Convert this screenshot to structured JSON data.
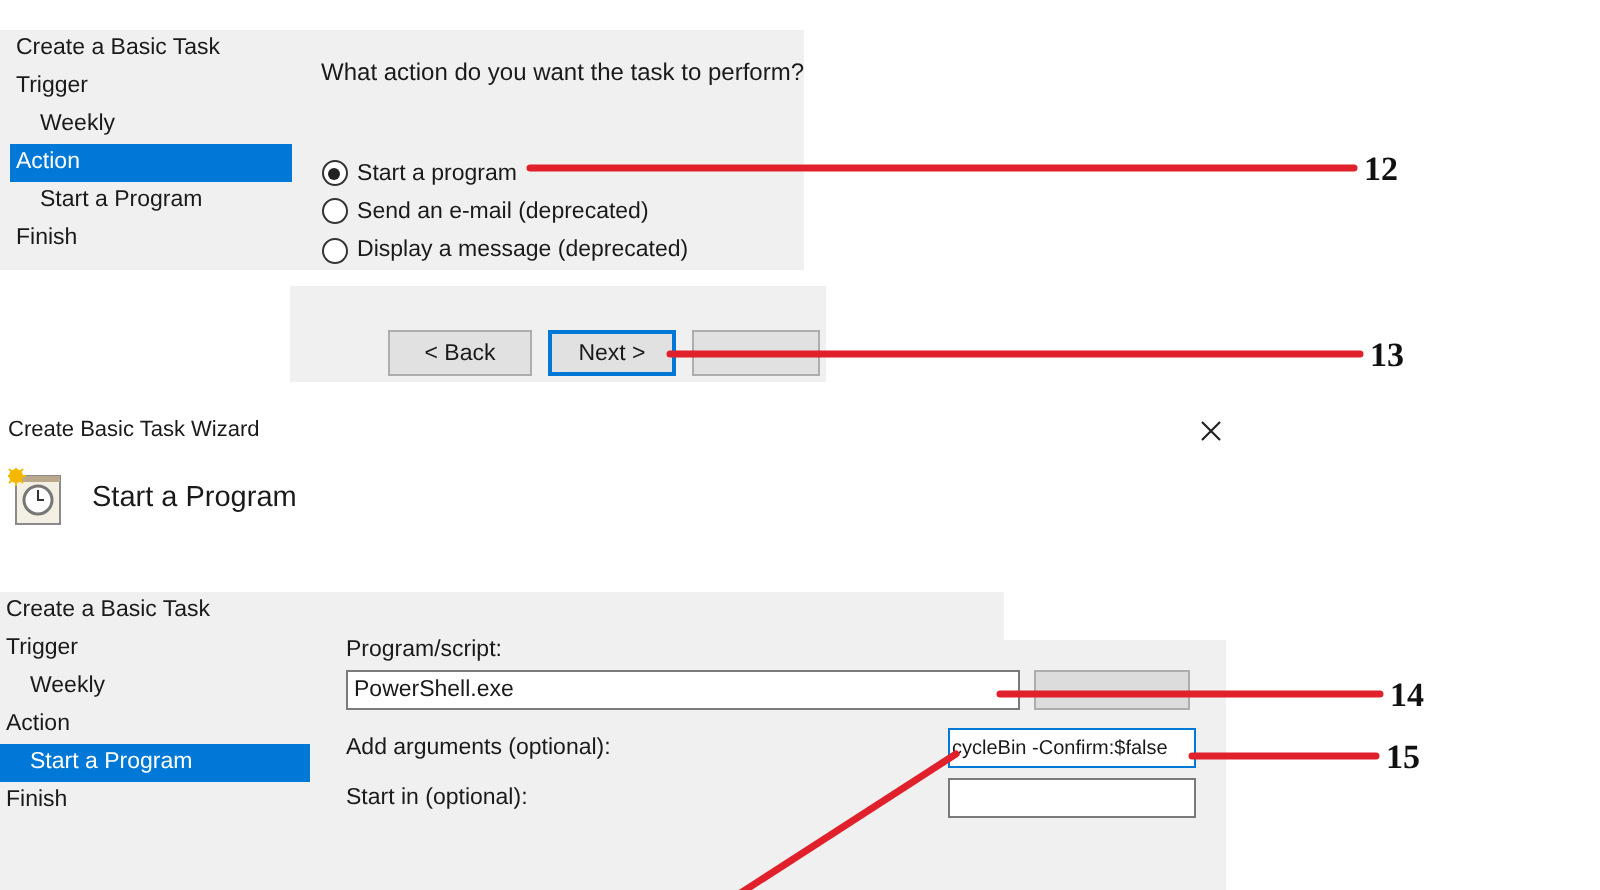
{
  "action_step": {
    "sidebar": [
      {
        "label": "Create a Basic Task",
        "selected": false
      },
      {
        "label": "Trigger",
        "selected": false,
        "children": [
          {
            "label": "Weekly",
            "selected": false
          }
        ]
      },
      {
        "label": "Action",
        "selected": true,
        "children": [
          {
            "label": "Start a Program",
            "selected": false
          }
        ]
      },
      {
        "label": "Finish",
        "selected": false
      }
    ],
    "question": "What action do you want the task to perform?",
    "options": [
      {
        "label": "Start a program",
        "selected": true
      },
      {
        "label": "Send an e-mail (deprecated)",
        "selected": false
      },
      {
        "label": "Display a message (deprecated)",
        "selected": false
      }
    ],
    "buttons": [
      {
        "label": "< Back",
        "default": false
      },
      {
        "label": "Next >",
        "default": true
      },
      {
        "default": false
      }
    ]
  },
  "wizard": {
    "title": "Create Basic Task Wizard",
    "heading": "Start a Program",
    "sidebar": [
      {
        "label": "Create a Basic Task",
        "selected": false
      },
      {
        "label": "Trigger",
        "selected": false,
        "children": [
          {
            "label": "Weekly",
            "selected": false
          }
        ]
      },
      {
        "label": "Action",
        "selected": false,
        "children": [
          {
            "label": "Start a Program",
            "selected": true
          }
        ]
      },
      {
        "label": "Finish",
        "selected": false
      }
    ],
    "fields": [
      {
        "label": "Program/script:",
        "value": "PowerShell.exe",
        "focused": false
      },
      {
        "label": "Add arguments (optional):",
        "value": "cycleBin -Confirm:$false",
        "focused": true
      },
      {
        "label": "Start in (optional):",
        "focused": false
      }
    ]
  },
  "callouts": [
    {
      "number": "12"
    },
    {
      "number": "13"
    },
    {
      "number": "14"
    },
    {
      "number": "15"
    }
  ]
}
